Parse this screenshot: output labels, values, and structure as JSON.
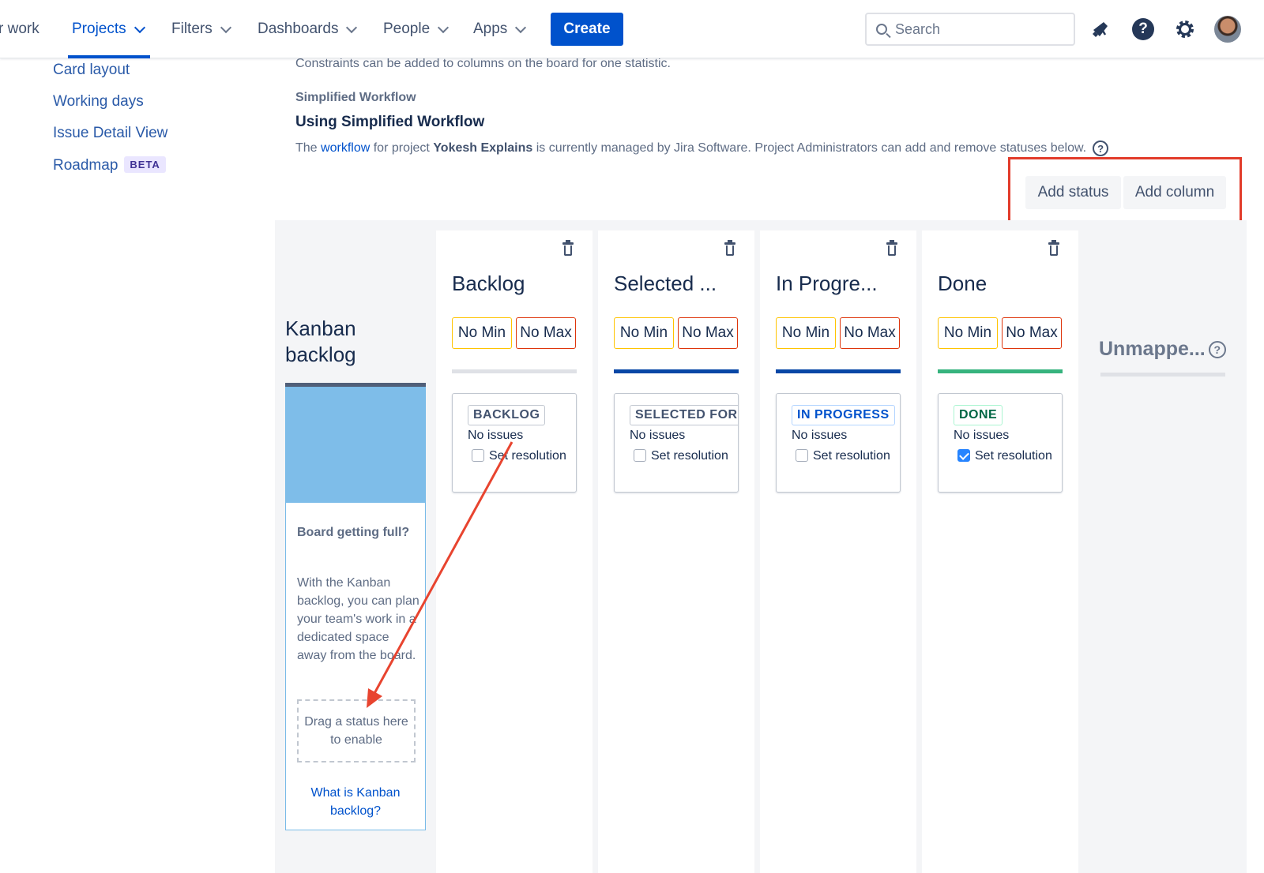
{
  "nav": {
    "items": [
      {
        "label": "r work"
      },
      {
        "label": "Projects",
        "active": true
      },
      {
        "label": "Filters"
      },
      {
        "label": "Dashboards"
      },
      {
        "label": "People"
      },
      {
        "label": "Apps"
      }
    ],
    "create_label": "Create",
    "search_placeholder": "Search",
    "icons": [
      "notification-icon",
      "help-icon",
      "settings-icon",
      "avatar"
    ]
  },
  "sidebar": {
    "items": [
      {
        "label": "Card layout"
      },
      {
        "label": "Working days"
      },
      {
        "label": "Issue Detail View"
      },
      {
        "label": "Roadmap",
        "badge": "BETA"
      }
    ]
  },
  "header": {
    "constraint_note": "Constraints can be added to columns on the board for one statistic.",
    "workflow_label": "Simplified Workflow",
    "workflow_title": "Using Simplified Workflow",
    "desc_prefix": "The",
    "desc_link": "workflow",
    "desc_mid": "for project",
    "desc_project": "Yokesh Explains",
    "desc_suffix": "is currently managed by Jira Software. Project Administrators can add and remove statuses below."
  },
  "actions": {
    "add_status": "Add status",
    "add_column": "Add column"
  },
  "kanban_backlog": {
    "title": "Kanban backlog",
    "heading": "Board getting full?",
    "body": "With the Kanban backlog, you can plan your team's work in a dedicated space away from the board.",
    "drop_text": "Drag a status here to enable",
    "link": "What is Kanban backlog?"
  },
  "columns": [
    {
      "title": "Backlog",
      "min": "No Min",
      "max": "No Max",
      "bar_color": "#dfe1e6",
      "status": "BACKLOG",
      "status_color": "#42526e",
      "issues": "No issues",
      "resolution": "Set resolution",
      "resolution_checked": false
    },
    {
      "title": "Selected ...",
      "min": "No Min",
      "max": "No Max",
      "bar_color": "#0747a6",
      "status": "SELECTED FOR",
      "status_color": "#42526e",
      "issues": "No issues",
      "resolution": "Set resolution",
      "resolution_checked": false
    },
    {
      "title": "In Progre...",
      "min": "No Min",
      "max": "No Max",
      "bar_color": "#0747a6",
      "status": "IN PROGRESS",
      "status_color": "#0052cc",
      "issues": "No issues",
      "resolution": "Set resolution",
      "resolution_checked": false
    },
    {
      "title": "Done",
      "min": "No Min",
      "max": "No Max",
      "bar_color": "#36b37e",
      "status": "DONE",
      "status_color": "#006644",
      "issues": "No issues",
      "resolution": "Set resolution",
      "resolution_checked": true
    }
  ],
  "unmapped": {
    "title": "Unmappe..."
  },
  "colors": {
    "accent": "#0052cc",
    "highlight_box": "#e23b2a",
    "annotation_arrow": "#e8442f"
  }
}
